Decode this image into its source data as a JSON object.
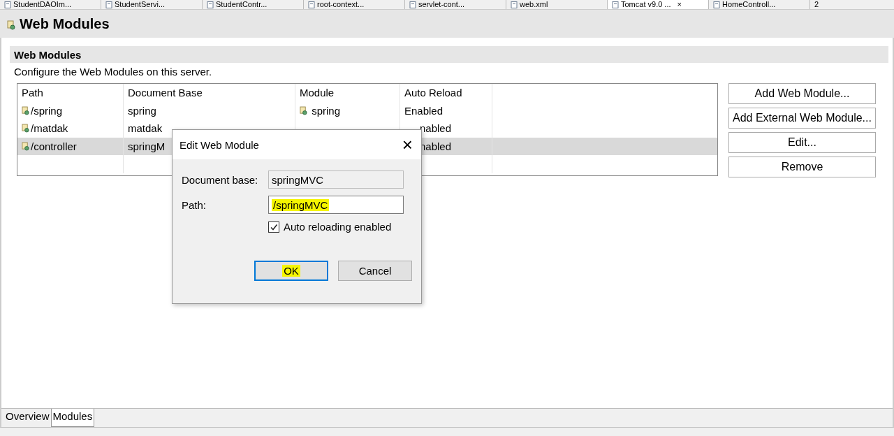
{
  "editor_tabs": [
    {
      "label": "StudentDAOIm...",
      "selected": false
    },
    {
      "label": "StudentServi...",
      "selected": false
    },
    {
      "label": "StudentContr...",
      "selected": false
    },
    {
      "label": "root-context...",
      "selected": false
    },
    {
      "label": "servlet-cont...",
      "selected": false
    },
    {
      "label": "web.xml",
      "selected": false
    },
    {
      "label": "Tomcat v9.0 ...",
      "selected": true,
      "close": "×"
    },
    {
      "label": "HomeControll...",
      "selected": false
    },
    {
      "label": "2",
      "selected": false,
      "kind": "overflow"
    }
  ],
  "page_title": "Web Modules",
  "section": {
    "title": "Web Modules",
    "description": "Configure the Web Modules on this server."
  },
  "table": {
    "columns": [
      "Path",
      "Document Base",
      "Module",
      "Auto Reload"
    ],
    "rows": [
      {
        "path": "/spring",
        "document_base": "spring",
        "module": "spring",
        "auto_reload": "Enabled",
        "selected": false
      },
      {
        "path": "/matdak",
        "document_base": "matdak",
        "auto_reload": "nabled",
        "selected": false
      },
      {
        "path": "/controller",
        "document_base": "springM",
        "auto_reload": "nabled",
        "selected": true
      }
    ]
  },
  "buttons": [
    "Add Web Module...",
    "Add External Web Module...",
    "Edit...",
    "Remove"
  ],
  "dialog": {
    "title": "Edit Web Module",
    "close": "×",
    "fields": [
      {
        "label": "Document base:",
        "value": "springMVC",
        "disabled": true,
        "highlighted": false
      },
      {
        "label": "Path:",
        "value": "/springMVC",
        "disabled": false,
        "highlighted": true
      }
    ],
    "checkbox": {
      "label": "Auto reloading enabled",
      "checked": true
    },
    "buttons": [
      {
        "label": "OK",
        "default": true,
        "highlighted": true
      },
      {
        "label": "Cancel",
        "default": false,
        "highlighted": false
      }
    ]
  },
  "bottom_tabs": [
    {
      "label": "Overview",
      "selected": false
    },
    {
      "label": "Modules",
      "selected": true
    }
  ]
}
